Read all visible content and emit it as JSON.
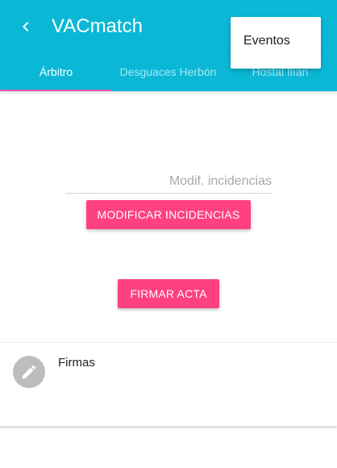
{
  "app": {
    "title": "VACmatch"
  },
  "tabs": [
    {
      "label": "Árbitro",
      "active": true
    },
    {
      "label": "Desguaces Herbón",
      "active": false
    },
    {
      "label": "Hostal Ilían",
      "active": false
    }
  ],
  "menu": {
    "items": [
      {
        "label": "Eventos"
      }
    ]
  },
  "incidents": {
    "placeholder": "Modif. incidencias",
    "value": "",
    "modify_button_label": "MODIFICAR INCIDENCIAS"
  },
  "sign": {
    "button_label": "FIRMAR ACTA"
  },
  "signatures_card": {
    "title": "Firmas",
    "icon": "pencil-icon"
  },
  "colors": {
    "primary": "#0ab8d6",
    "accent": "#ff4081",
    "tab_indicator": "#e85ab4"
  }
}
